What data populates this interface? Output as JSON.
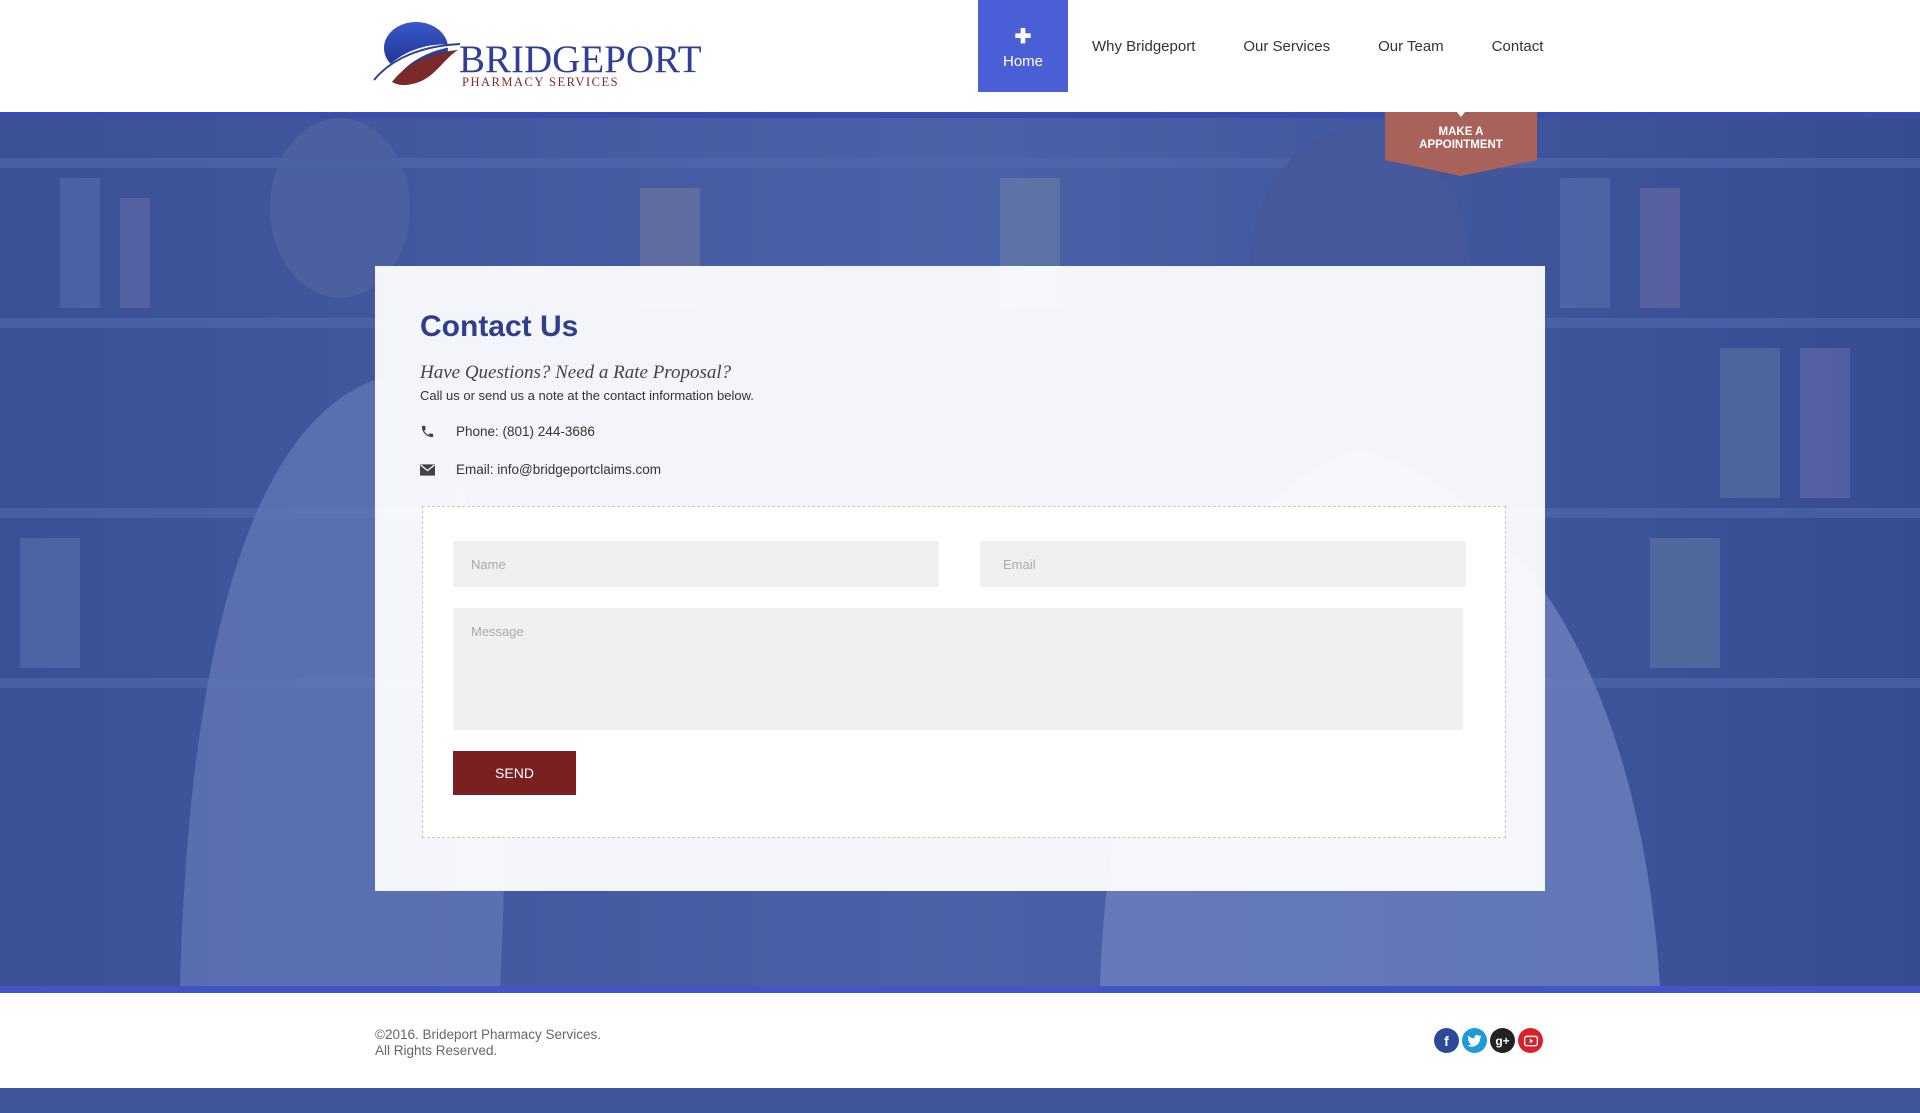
{
  "logo": {
    "name": "BRIDGEPORT",
    "tagline": "PHARMACY SERVICES"
  },
  "nav": {
    "items": [
      {
        "label": "Home",
        "active": true
      },
      {
        "label": "Why Bridgeport"
      },
      {
        "label": "Our Services"
      },
      {
        "label": "Our Team"
      },
      {
        "label": "Contact"
      }
    ]
  },
  "appointment": {
    "line1": "MAKE A",
    "line2": "APPOINTMENT"
  },
  "contact": {
    "title": "Contact Us",
    "subtitle": "Have Questions? Need a Rate Proposal?",
    "description": "Call us or send us a note at the contact information below.",
    "phone": "Phone: (801) 244-3686",
    "email": "Email: info@bridgeportclaims.com"
  },
  "form": {
    "name_placeholder": "Name",
    "email_placeholder": "Email",
    "message_placeholder": "Message",
    "send_label": "SEND"
  },
  "footer": {
    "copyright_line1": "©2016. Brideport Pharmacy Services.",
    "copyright_line2": "All Rights Reserved.",
    "socials": [
      "facebook-icon",
      "twitter-icon",
      "google-plus-icon",
      "youtube-icon"
    ]
  },
  "colors": {
    "brand_blue": "#2f3f96",
    "nav_active": "#4a5fd6",
    "send_button": "#7a2020",
    "ribbon": "#a8625a"
  }
}
